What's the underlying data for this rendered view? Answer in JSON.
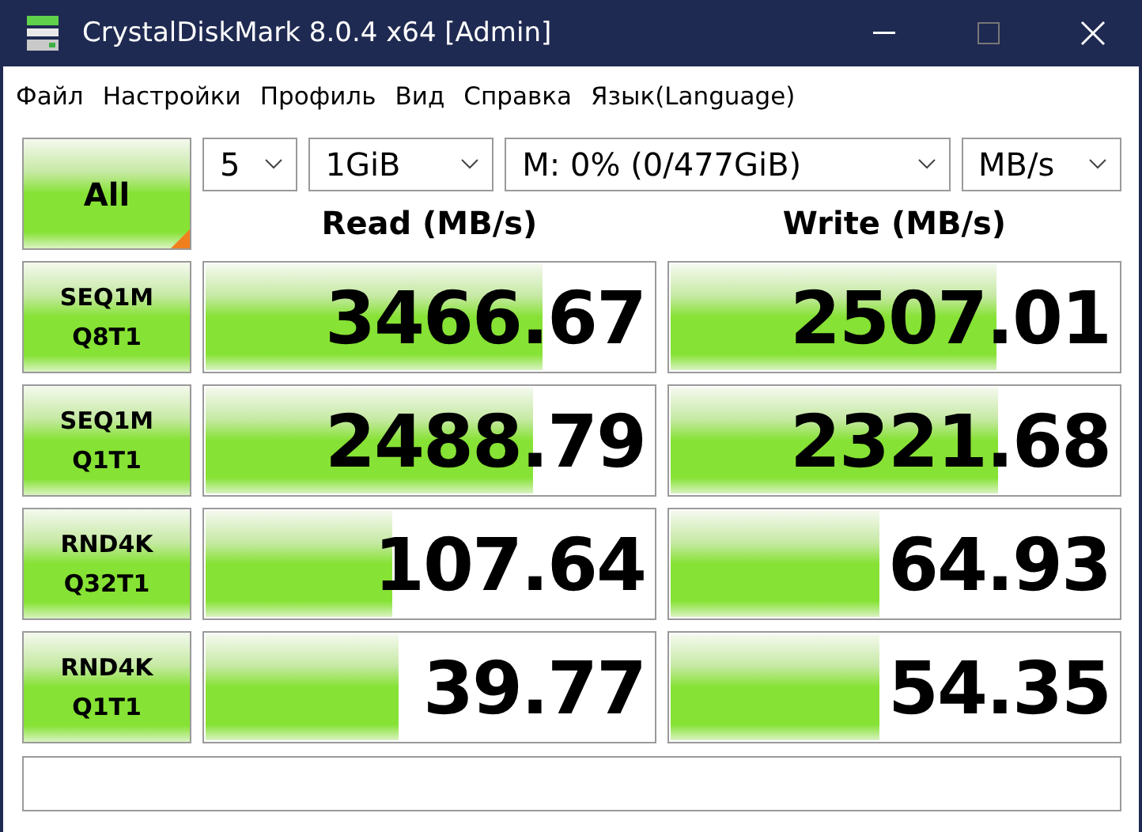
{
  "window": {
    "title": "CrystalDiskMark 8.0.4 x64 [Admin]"
  },
  "menu": [
    "Файл",
    "Настройки",
    "Профиль",
    "Вид",
    "Справка",
    "Язык(Language)"
  ],
  "all_button": {
    "label": "All"
  },
  "selectors": [
    {
      "value": "5"
    },
    {
      "value": "1GiB"
    },
    {
      "value": "M: 0% (0/477GiB)"
    },
    {
      "value": "MB/s"
    }
  ],
  "columns": [
    "Read (MB/s)",
    "Write (MB/s)"
  ],
  "rows": [
    {
      "test": [
        "SEQ1M",
        "Q8T1"
      ],
      "read": {
        "value": "3466.67",
        "level": 0.756
      },
      "write": {
        "value": "2507.01",
        "level": 0.73
      }
    },
    {
      "test": [
        "SEQ1M",
        "Q1T1"
      ],
      "read": {
        "value": "2488.79",
        "level": 0.735
      },
      "write": {
        "value": "2321.68",
        "level": 0.735
      }
    },
    {
      "test": [
        "RND4K",
        "Q32T1"
      ],
      "read": {
        "value": "107.64",
        "level": 0.42
      },
      "write": {
        "value": "64.93",
        "level": 0.47
      }
    },
    {
      "test": [
        "RND4K",
        "Q1T1"
      ],
      "read": {
        "value": "39.77",
        "level": 0.435
      },
      "write": {
        "value": "54.35",
        "level": 0.47
      }
    }
  ]
}
